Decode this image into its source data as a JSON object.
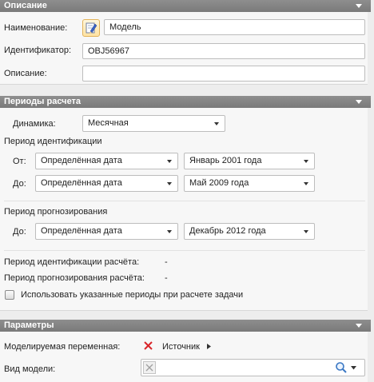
{
  "description_section": {
    "title": "Описание",
    "name_label": "Наименование:",
    "name_value": "Модель",
    "id_label": "Идентификатор:",
    "id_value": "OBJ56967",
    "desc_label": "Описание:",
    "desc_value": ""
  },
  "periods_section": {
    "title": "Периоды расчета",
    "dynamics_label": "Динамика:",
    "dynamics_value": "Месячная",
    "ident_group_label": "Период идентификации",
    "from_label": "От:",
    "from_type": "Определённая дата",
    "from_date": "Январь 2001 года",
    "to_label": "До:",
    "to_type": "Определённая дата",
    "to_date": "Май 2009 года",
    "forecast_group_label": "Период прогнозирования",
    "forecast_to_label": "До:",
    "forecast_to_type": "Определённая дата",
    "forecast_to_date": "Декабрь 2012 года",
    "ident_calc_label": "Период идентификации расчёта:",
    "ident_calc_value": "-",
    "forecast_calc_label": "Период прогнозирования расчёта:",
    "forecast_calc_value": "-",
    "use_periods_label": "Использовать указанные периоды при расчете задачи",
    "use_periods_checked": false
  },
  "params_section": {
    "title": "Параметры",
    "modeled_var_label": "Моделируемая переменная:",
    "modeled_var_value": "Источник",
    "model_type_label": "Вид модели:",
    "model_type_value": ""
  },
  "icons": {
    "collapse": "collapse-triangle-icon",
    "edit": "edit-pencil-icon",
    "remove": "red-cross-icon",
    "search": "magnifier-icon"
  },
  "colors": {
    "header_bg": "#7a7a7a",
    "panel_bg": "#f7f7f7",
    "accent_red": "#d9262b",
    "edit_btn": "#ffe3a3"
  }
}
